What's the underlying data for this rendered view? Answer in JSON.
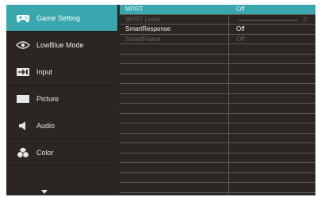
{
  "menu": {
    "items": [
      {
        "label": "Game Setting",
        "icon": "gamepad-icon",
        "active": true
      },
      {
        "label": "LowBlue Mode",
        "icon": "eye-icon",
        "active": false
      },
      {
        "label": "Input",
        "icon": "input-icon",
        "active": false
      },
      {
        "label": "Picture",
        "icon": "picture-icon",
        "active": false
      },
      {
        "label": "Audio",
        "icon": "speaker-icon",
        "active": false
      },
      {
        "label": "Color",
        "icon": "palette-icon",
        "active": false
      }
    ],
    "more_icon": "chevron-down-icon"
  },
  "panel": {
    "rows": [
      {
        "name": "MPRT",
        "value": "Off",
        "selected": true,
        "dim": false
      },
      {
        "name": "MPRT Level",
        "value": "0",
        "selected": false,
        "dim": true,
        "slider": true
      },
      {
        "name": "SmartResponse",
        "value": "Off",
        "selected": false,
        "dim": false
      },
      {
        "name": "SmartFrame",
        "value": "Off",
        "selected": false,
        "dim": true
      }
    ]
  },
  "colors": {
    "accent": "#3aa6ad",
    "background": "#2b2622",
    "dim_text": "#6b6460"
  }
}
